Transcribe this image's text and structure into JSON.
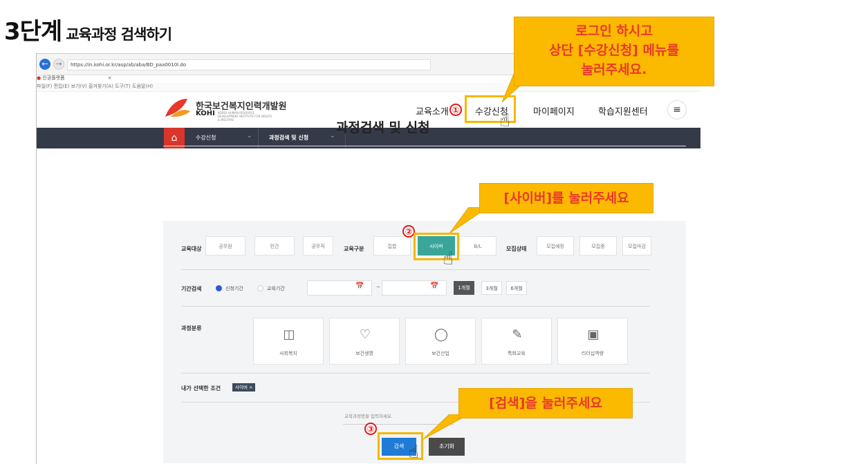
{
  "slide": {
    "step": "3단계",
    "title": "교육과정 검색하기"
  },
  "browser": {
    "url": "https://in.kohi.or.kr/asp/ab/aba/BD_paa0010l.do",
    "tab_label": "인권플랫폼",
    "menu": "파일(F)  편집(E)  보기(V)  즐겨찾기(A)  도구(T)  도움말(H)"
  },
  "header": {
    "logo_name": "한국보건복지인력개발원",
    "logo_eng": "KOHI",
    "logo_eng_small": "KOREA HUMAN RESOURCE DEVELOPMENT INSTITUTE FOR HEALTH & WELFARE",
    "nav": [
      "교육소개",
      "수강신청",
      "마이페이지",
      "학습지원센터"
    ],
    "menu_icon": "hamburger-icon"
  },
  "breadcrumb": {
    "home_icon": "home-icon",
    "first": "수강신청",
    "second": "과정검색 및 신청"
  },
  "page": {
    "title": "과정검색 및 신청"
  },
  "filters": {
    "target_label": "교육대상",
    "targets": [
      "공무원",
      "민간",
      "공무직"
    ],
    "type_label": "교육구분",
    "types": [
      "집합",
      "사이버",
      "B/L"
    ],
    "selected_type": "사이버",
    "status_label": "모집상태",
    "statuses": [
      "모집예정",
      "모집중",
      "모집마감"
    ],
    "period_label": "기간검색",
    "period_radio_on": "신청기간",
    "period_radio_off": "교육기간",
    "tilde": "~",
    "period_buttons": [
      "1개월",
      "3개월",
      "6개월"
    ],
    "category_label": "과정분류",
    "categories": [
      {
        "label": "사회복지",
        "icon": "medical-kit-icon"
      },
      {
        "label": "보건생명",
        "icon": "hands-heart-icon"
      },
      {
        "label": "보건산업",
        "icon": "lightbulb-icon"
      },
      {
        "label": "특화교육",
        "icon": "edit-icon"
      },
      {
        "label": "리더십역량",
        "icon": "laptop-icon"
      }
    ],
    "selected_label": "내가 선택한 조건",
    "chip": "사이버 ×"
  },
  "search": {
    "placeholder": "교육과정명을 입력하세요.",
    "search_label": "검색",
    "reset_label": "초기화"
  },
  "annotations": {
    "callout_login": "로그인 하시고\n상단 [수강신청] 메뉴를\n눌러주세요.",
    "callout_cyber": "[사이버]를 눌러주세요",
    "callout_search": "[검색]을 눌러주세요",
    "num1": "①",
    "num2": "②",
    "num3": "③",
    "callout_color": "#fbb900",
    "text_color": "#e8392a",
    "highlight_color": "#f4b800"
  }
}
